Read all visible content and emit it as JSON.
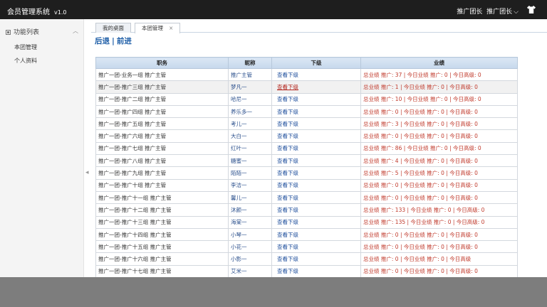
{
  "app": {
    "title": "会员管理系统",
    "version": "v1.0"
  },
  "header": {
    "user_label": "推广团长",
    "user_menu": "推广团长"
  },
  "sidebar": {
    "heading": "功能列表",
    "items": [
      {
        "label": "本团管理"
      },
      {
        "label": "个人资料"
      }
    ]
  },
  "tabs": [
    {
      "label": "我的桌面"
    },
    {
      "label": "本团管理"
    }
  ],
  "nav": {
    "back": "后退",
    "separator": "|",
    "forward": "前进"
  },
  "table": {
    "columns": [
      "职务",
      "昵称",
      "下级",
      "业绩"
    ],
    "rows": [
      {
        "role": "推广一团-业务一组 推广主管",
        "nick": "推广主管",
        "sub": "查看下级",
        "perf": "总业绩 推广: 37 | 今日业绩 推广: 0 | 今日高级: 0"
      },
      {
        "role": "推广一团-推广三组 推广主管",
        "nick": "梦凡一",
        "sub": "查看下级",
        "perf": "总业绩 推广: 1 | 今日业绩 推广: 0 | 今日高级: 0"
      },
      {
        "role": "推广一团-推广二组 推广主管",
        "nick": "哈尼一",
        "sub": "查看下级",
        "perf": "总业绩 推广: 10 | 今日业绩 推广: 0 | 今日高级: 0"
      },
      {
        "role": "推广一团-推广四组 推广主管",
        "nick": "养乐多一",
        "sub": "查看下级",
        "perf": "总业绩 推广: 0 | 今日业绩 推广: 0 | 今日高级: 0"
      },
      {
        "role": "推广一团-推广五组 推广主管",
        "nick": "考儿一",
        "sub": "查看下级",
        "perf": "总业绩 推广: 3 | 今日业绩 推广: 0 | 今日高级: 0"
      },
      {
        "role": "推广一团-推广六组 推广主管",
        "nick": "大白一",
        "sub": "查看下级",
        "perf": "总业绩 推广: 0 | 今日业绩 推广: 0 | 今日高级: 0"
      },
      {
        "role": "推广一团-推广七组 推广主管",
        "nick": "红叶一",
        "sub": "查看下级",
        "perf": "总业绩 推广: 86 | 今日业绩 推广: 0 | 今日高级: 0"
      },
      {
        "role": "推广一团-推广八组 推广主管",
        "nick": "糖蜜一",
        "sub": "查看下级",
        "perf": "总业绩 推广: 4 | 今日业绩 推广: 0 | 今日高级: 0"
      },
      {
        "role": "推广一团-推广九组 推广主管",
        "nick": "陌陌一",
        "sub": "查看下级",
        "perf": "总业绩 推广: 5 | 今日业绩 推广: 0 | 今日高级: 0"
      },
      {
        "role": "推广一团-推广十组 推广主管",
        "nick": "李洁一",
        "sub": "查看下级",
        "perf": "总业绩 推广: 0 | 今日业绩 推广: 0 | 今日高级: 0"
      },
      {
        "role": "推广一团-推广十一组 推广主管",
        "nick": "馨儿一",
        "sub": "查看下级",
        "perf": "总业绩 推广: 0 | 今日业绩 推广: 0 | 今日高级: 0"
      },
      {
        "role": "推广一团-推广十二组 推广主管",
        "nick": "沐颜一",
        "sub": "查看下级",
        "perf": "总业绩 推广: 133 | 今日业绩 推广: 0 | 今日高级: 0"
      },
      {
        "role": "推广一团-推广十三组 推广主管",
        "nick": "海棠一",
        "sub": "查看下级",
        "perf": "总业绩 推广: 135 | 今日业绩 推广: 0 | 今日高级: 0"
      },
      {
        "role": "推广一团-推广十四组 推广主管",
        "nick": "小琴一",
        "sub": "查看下级",
        "perf": "总业绩 推广: 0 | 今日业绩 推广: 0 | 今日高级: 0"
      },
      {
        "role": "推广一团-推广十五组 推广主管",
        "nick": "小花一",
        "sub": "查看下级",
        "perf": "总业绩 推广: 0 | 今日业绩 推广: 0 | 今日高级: 0"
      },
      {
        "role": "推广一团-推广十六组 推广主管",
        "nick": "小影一",
        "sub": "查看下级",
        "perf": "总业绩 推广: 0 | 今日业绩 推广: 0 | 今日高级"
      },
      {
        "role": "推广一团-推广十七组 推广主管",
        "nick": "艾米一",
        "sub": "查看下级",
        "perf": "总业绩 推广: 0 | 今日业绩 推广: 0 | 今日高级: 0"
      }
    ]
  },
  "colors": {
    "topbar": "#1e1e1e",
    "link": "#1f5fa8",
    "perf": "#c0392b",
    "overlay": "#7d7d7d"
  }
}
